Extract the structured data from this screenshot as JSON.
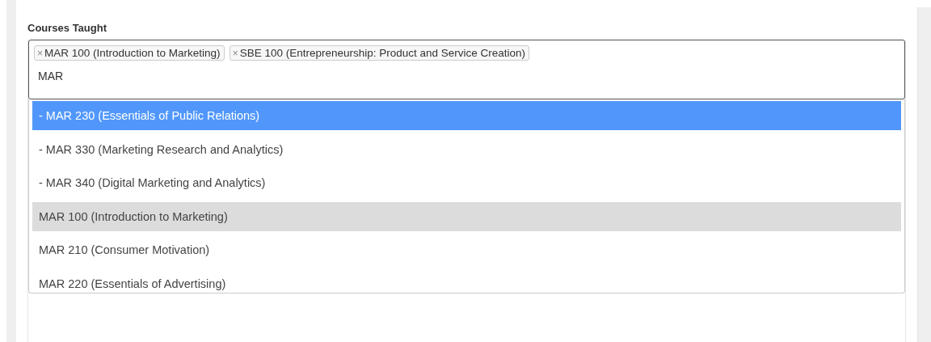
{
  "field": {
    "label": "Courses Taught",
    "tags": [
      {
        "remove": "×",
        "text": "MAR 100 (Introduction to Marketing)"
      },
      {
        "remove": "×",
        "text": "SBE 100 (Entrepreneurship: Product and Service Creation)"
      }
    ],
    "value": "MAR"
  },
  "options": [
    {
      "text": "- MAR 230 (Essentials of Public Relations)",
      "highlighted": true,
      "chosen": false
    },
    {
      "text": "- MAR 330 (Marketing Research and Analytics)",
      "highlighted": false,
      "chosen": false
    },
    {
      "text": "- MAR 340 (Digital Marketing and Analytics)",
      "highlighted": false,
      "chosen": false
    },
    {
      "text": "MAR 100 (Introduction to Marketing)",
      "highlighted": false,
      "chosen": true
    },
    {
      "text": "MAR 210 (Consumer Motivation)",
      "highlighted": false,
      "chosen": false
    },
    {
      "text": "MAR 220 (Essentials of Advertising)",
      "highlighted": false,
      "chosen": false
    }
  ]
}
